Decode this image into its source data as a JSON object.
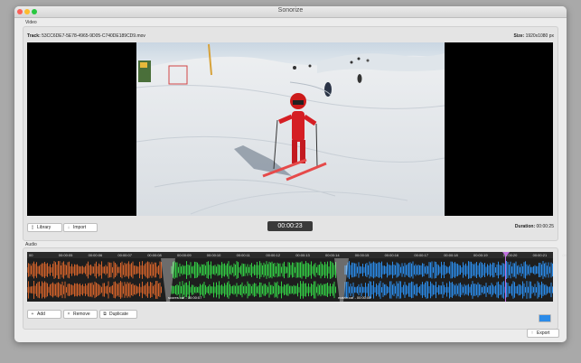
{
  "window": {
    "title": "Sonorize"
  },
  "video_section": {
    "label": "Video",
    "track_label": "Track:",
    "track_value": "53CC6DE7-5E78-4965-9D05-C740DE189CD9.mov",
    "size_label": "Size:",
    "size_value": "1920x1080 px",
    "library_button": "Library",
    "import_button": "Import",
    "timecode": "00:00:23",
    "duration_label": "Duration:",
    "duration_value": "00:00:25"
  },
  "audio_section": {
    "label": "Audio",
    "ruler_ticks": [
      "00",
      "00:00:05",
      "00:00:06",
      "00:00:07",
      "00:00:08",
      "00:00:09",
      "00:00:10",
      "00:00:11",
      "00:00:12",
      "00:00:13",
      "00:00:14",
      "00:00:15",
      "00:00:16",
      "00:00:17",
      "00:00:18",
      "00:00:19",
      "00:00:20",
      "00:00:21",
      "00:00:22",
      "00:00:23"
    ],
    "clips": [
      {
        "name": "",
        "color": "#d2622a"
      },
      {
        "name": "scores.caf - 00:00:07",
        "color": "#33cc44"
      },
      {
        "name": "matrix.caf - 00:00:09",
        "color": "#2b8be8"
      }
    ],
    "add_button": "Add",
    "remove_button": "Remove",
    "duplicate_button": "Duplicate",
    "selected_color": "#2b8be8"
  },
  "export_button": "Export"
}
